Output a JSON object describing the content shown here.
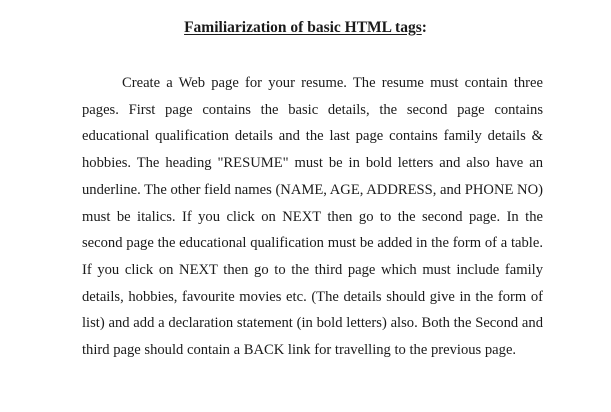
{
  "document": {
    "title_main": "Familiarization of basic HTML tags",
    "title_colon": ":",
    "paragraph": "Create a Web page for your resume. The resume must contain three pages. First page contains the basic details, the second page contains educational qualification details and the last page contains family details & hobbies. The heading \"RESUME\" must be in bold letters and also have an underline. The other field names (NAME, AGE, ADDRESS, and PHONE NO) must be italics. If you click on NEXT then go to the second page. In the second page the educational qualification must be added in the form of a table. If you click on NEXT then go to the third page which must include family details, hobbies, favourite movies etc. (The details should give in the form of list) and add a declaration statement (in bold letters) also. Both the Second and third page should contain a BACK link for travelling to the previous page."
  }
}
